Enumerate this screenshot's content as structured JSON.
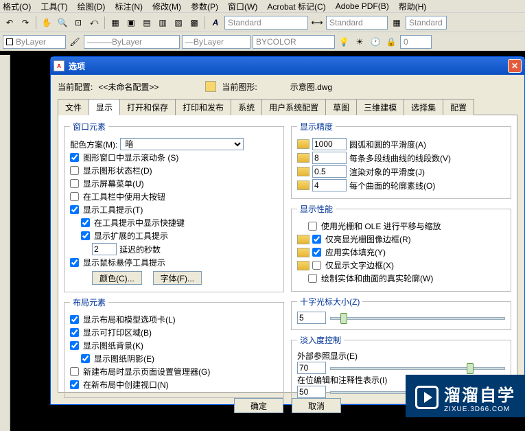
{
  "menu": [
    "格式(O)",
    "工具(T)",
    "绘图(D)",
    "标注(N)",
    "修改(M)",
    "参数(P)",
    "窗口(W)",
    "Acrobat 标记(C)",
    "Adobe PDF(B)",
    "帮助(H)"
  ],
  "toolbar": {
    "style1": "Standard",
    "style2": "Standard",
    "style3": "Standard",
    "layer": "ByLayer",
    "lt": "ByLayer",
    "ltb": "ByLayer",
    "col": "BYCOLOR"
  },
  "dlg": {
    "title": "选项",
    "profileLabel": "当前配置:",
    "profileName": "<<未命名配置>>",
    "drawingLabel": "当前图形:",
    "drawingName": "示意图.dwg",
    "tabs": [
      "文件",
      "显示",
      "打开和保存",
      "打印和发布",
      "系统",
      "用户系统配置",
      "草图",
      "三维建模",
      "选择集",
      "配置"
    ],
    "activeTab": 1,
    "winElems": {
      "legend": "窗口元素",
      "schemeLabel": "配色方案(M):",
      "schemeVal": "暗",
      "c1": "图形窗口中显示滚动条 (S)",
      "c2": "显示图形状态栏(D)",
      "c3": "显示屏幕菜单(U)",
      "c4": "在工具栏中使用大按钮",
      "c5": "显示工具提示(T)",
      "c6": "在工具提示中显示快捷键",
      "c7": "显示扩展的工具提示",
      "delayVal": "2",
      "delayLbl": "延迟的秒数",
      "c8": "显示鼠标悬停工具提示",
      "btnColor": "颜色(C)...",
      "btnFont": "字体(F)..."
    },
    "layoutElems": {
      "legend": "布局元素",
      "l1": "显示布局和模型选项卡(L)",
      "l2": "显示可打印区域(B)",
      "l3": "显示图纸背景(K)",
      "l4": "显示图纸阴影(E)",
      "l5": "新建布局时显示页面设置管理器(G)",
      "l6": "在新布局中创建视口(N)"
    },
    "dispPrec": {
      "legend": "显示精度",
      "r1v": "1000",
      "r1l": "圆弧和圆的平滑度(A)",
      "r2v": "8",
      "r2l": "每条多段线曲线的线段数(V)",
      "r3v": "0.5",
      "r3l": "渲染对象的平滑度(J)",
      "r4v": "4",
      "r4l": "每个曲面的轮廓素线(O)"
    },
    "dispPerf": {
      "legend": "显示性能",
      "p1": "使用光栅和 OLE 进行平移与缩放",
      "p2": "仅亮显光栅图像边框(R)",
      "p3": "应用实体填充(Y)",
      "p4": "仅显示文字边框(X)",
      "p5": "绘制实体和曲面的真实轮廓(W)"
    },
    "cross": {
      "legend": "十字光标大小(Z)",
      "val": "5"
    },
    "fade": {
      "legend": "淡入度控制",
      "l1": "外部参照显示(E)",
      "v1": "70",
      "l2": "在位编辑和注释性表示(I)",
      "v2": "50"
    },
    "ok": "确定",
    "cancel": "取消"
  },
  "watermark": {
    "brand": "溜溜自学",
    "sub": "ZIXUE.3D66.COM"
  }
}
